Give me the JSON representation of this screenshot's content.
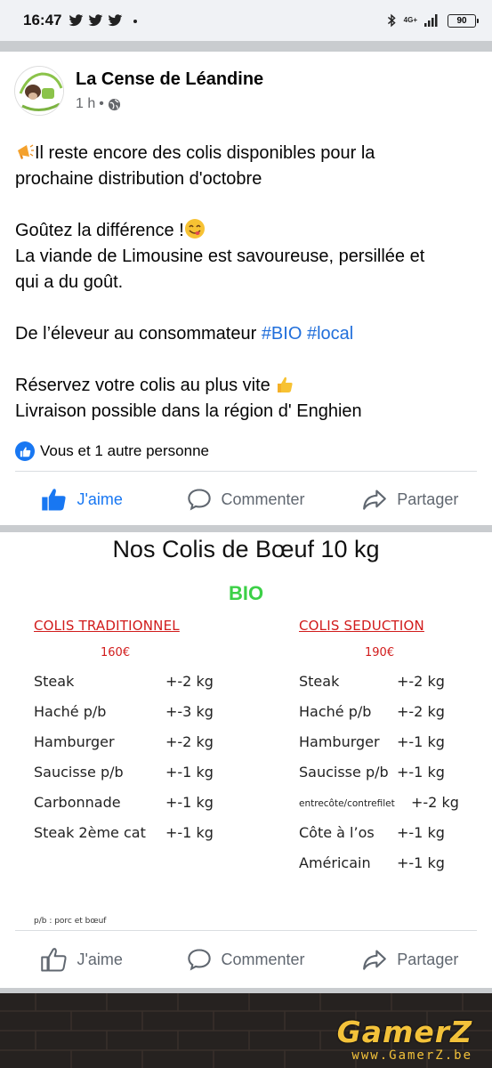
{
  "status": {
    "time": "16:47",
    "network": "4G+",
    "battery": "90"
  },
  "post": {
    "page_name": "La Cense de Léandine",
    "time": "1 h",
    "paragraphs": [
      {
        "line1": "Il reste encore des colis disponibles pour la",
        "line2": "prochaine distribution d'octobre"
      },
      {
        "line1": "Goûtez la différence !",
        "line2": "La viande de Limousine est savoureuse, persillée et",
        "line3": "qui a du goût."
      },
      {
        "text": "De l’éleveur au consommateur",
        "tag1": "#BIO",
        "tag2": "#local"
      },
      {
        "line1": "Réservez votre colis au plus vite",
        "line2": "Livraison possible dans la région d' Enghien"
      }
    ],
    "reactions": "Vous et 1 autre personne",
    "actions": {
      "like": "J'aime",
      "comment": "Commenter",
      "share": "Partager"
    }
  },
  "image_post": {
    "title": "Nos Colis de Bœuf 10 kg",
    "bio": "BIO",
    "left": {
      "heading": "COLIS TRADITIONNEL",
      "price": "160€",
      "rows": [
        {
          "item": "Steak",
          "qty": "+-2 kg"
        },
        {
          "item": "Haché p/b",
          "qty": "+-3 kg"
        },
        {
          "item": "Hamburger",
          "qty": "+-2 kg"
        },
        {
          "item": "Saucisse p/b",
          "qty": "+-1 kg"
        },
        {
          "item": "Carbonnade",
          "qty": "+-1 kg"
        },
        {
          "item": "Steak 2ème cat",
          "qty": "+-1 kg"
        }
      ]
    },
    "right": {
      "heading": "COLIS SEDUCTION",
      "price": "190€",
      "rows": [
        {
          "item": "Steak",
          "qty": "+-2 kg"
        },
        {
          "item": "Haché p/b",
          "qty": "+-2 kg"
        },
        {
          "item": "Hamburger",
          "qty": "+-1 kg"
        },
        {
          "item": "Saucisse p/b",
          "qty": "+-1 kg"
        },
        {
          "item": "entrecôte/contrefilet",
          "qty": "+-2 kg"
        },
        {
          "item": "Côte à l’os",
          "qty": "+-1 kg"
        },
        {
          "item": "Américain",
          "qty": "+-1 kg"
        }
      ]
    },
    "footnote": "p/b : porc et bœuf",
    "actions": {
      "like": "J'aime",
      "comment": "Commenter",
      "share": "Partager"
    }
  },
  "watermark": {
    "logo": "GamerZ",
    "site": "www.GamerZ.be"
  },
  "colors": {
    "facebook_blue": "#1877f2",
    "hashtag": "#216fdb",
    "red": "#d11b1b",
    "green": "#3cd047"
  }
}
